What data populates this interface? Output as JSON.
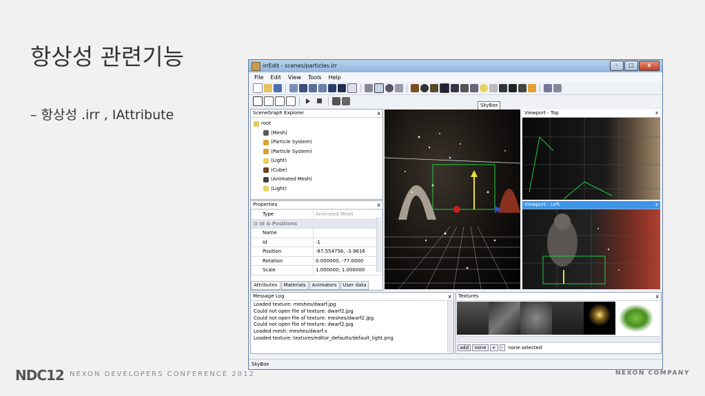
{
  "slide": {
    "title": "항상성 관련기능",
    "bullet": "– 항상성 .irr , IAttribute",
    "footer_logo": "NDC12",
    "footer_conference": "NEXON DEVELOPERS CONFERENCE 2012",
    "footer_company": "NEXON COMPANY"
  },
  "window": {
    "title": "irrEdit - scenes/particles.irr",
    "controls": {
      "minimize": "–",
      "maximize": "□",
      "close": "x"
    },
    "menu": [
      "File",
      "Edit",
      "View",
      "Tools",
      "Help"
    ],
    "tooltip": "SkyBox",
    "status": "SkyBox"
  },
  "scenegraph": {
    "title": "SceneGraph Explorer",
    "close": "x",
    "root": "root",
    "items": [
      {
        "label": "(Mesh)",
        "icon": "mesh-icon",
        "color": "#5a5a5a"
      },
      {
        "label": "(Particle System)",
        "icon": "particle-icon",
        "color": "#d9a030"
      },
      {
        "label": "(Particle System)",
        "icon": "particle-icon",
        "color": "#d9a030"
      },
      {
        "label": "(Light)",
        "icon": "light-bulb-icon",
        "color": "#e8d060"
      },
      {
        "label": "(Cube)",
        "icon": "cube-icon",
        "color": "#6b4a20"
      },
      {
        "label": "(Animated Mesh)",
        "icon": "animated-mesh-icon",
        "color": "#444444"
      },
      {
        "label": "(Light)",
        "icon": "light-bulb-icon",
        "color": "#e8d060"
      }
    ]
  },
  "properties": {
    "title": "Properties",
    "close": "x",
    "type_key": "Type",
    "type_value": "Animated Mesh",
    "group": "Id & Positions",
    "rows": [
      {
        "key": "Name",
        "value": ""
      },
      {
        "key": "Id",
        "value": "-1"
      },
      {
        "key": "Position",
        "value": "-87.554756, -3.9616"
      },
      {
        "key": "Rotation",
        "value": "0.000000, -77.0000"
      },
      {
        "key": "Scale",
        "value": "1.000000, 1.000000"
      }
    ],
    "tabs": [
      "Attributes",
      "Materials",
      "Animators",
      "User data"
    ]
  },
  "viewports": {
    "top": "Viewport - Top",
    "left": "Viewport - Left",
    "close": "x"
  },
  "message_log": {
    "title": "Message Log",
    "close": "x",
    "lines": [
      "Loaded texture: meshes/dwarf.jpg",
      "Could not open file of texture: dwarf2.jpg",
      "Could not open file of texture: meshes/dwarf2.jpg",
      "Could not open file of texture: dwarf2.jpg",
      "Loaded mesh: meshes/dwarf.x",
      "Loaded texture: textures/editor_defaults/default_light.png"
    ]
  },
  "textures": {
    "title": "Textures",
    "close": "x",
    "add": "add",
    "none": "none",
    "plus": "+",
    "minus": "-",
    "selection": "none selected"
  }
}
